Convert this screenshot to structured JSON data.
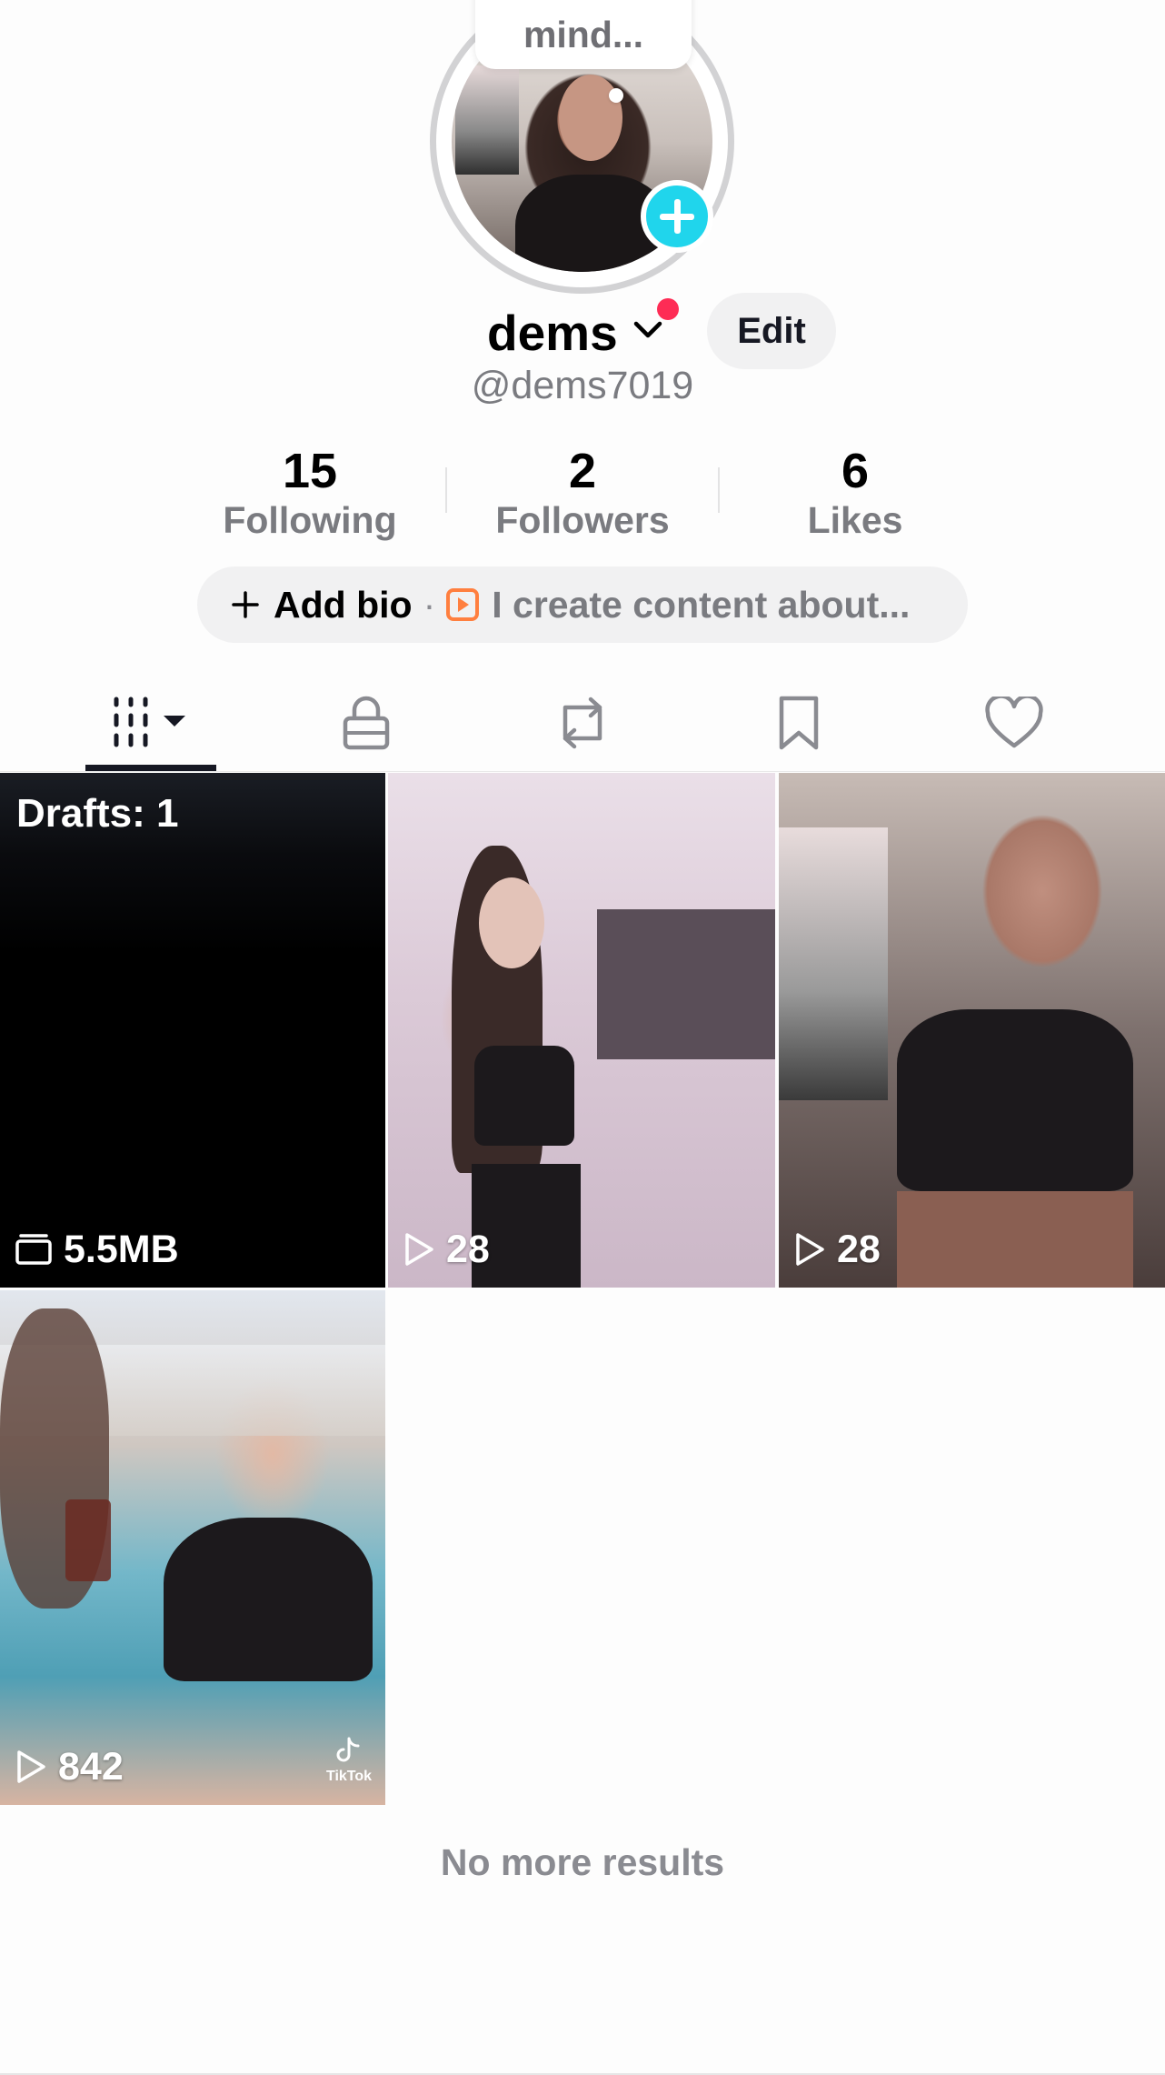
{
  "profile": {
    "bubble_text": "mind...",
    "display_name": "dems",
    "edit_label": "Edit",
    "username": "@dems7019"
  },
  "stats": [
    {
      "value": "15",
      "label": "Following"
    },
    {
      "value": "2",
      "label": "Followers"
    },
    {
      "value": "6",
      "label": "Likes"
    }
  ],
  "bio": {
    "add_label": "Add bio",
    "separator": "·",
    "suggestion": "I create content about..."
  },
  "tabs": [
    {
      "icon": "grid-videos-icon",
      "active": true
    },
    {
      "icon": "lock-icon",
      "active": false
    },
    {
      "icon": "repost-icon",
      "active": false
    },
    {
      "icon": "bookmark-icon",
      "active": false
    },
    {
      "icon": "heart-icon",
      "active": false
    }
  ],
  "grid": {
    "drafts": {
      "label": "Drafts: 1",
      "size": "5.5MB"
    },
    "videos": [
      {
        "views": "28"
      },
      {
        "views": "28"
      },
      {
        "views": "842",
        "watermark": "TikTok"
      }
    ]
  },
  "footer": {
    "no_more": "No more results"
  },
  "colors": {
    "accent_cyan": "#20d5ec",
    "notification_red": "#fe2c55",
    "text_primary": "#161823",
    "text_secondary": "#7a7b80",
    "bio_icon_orange": "#ff7f3f"
  }
}
